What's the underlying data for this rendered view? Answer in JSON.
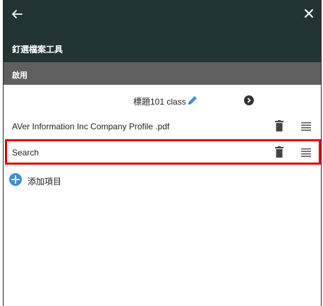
{
  "header": {
    "title": "釘選檔案工具",
    "enabled_label": "啟用"
  },
  "content": {
    "class_title": "標題101 class",
    "items": [
      {
        "name": "AVer Information Inc  Company Profile .pdf"
      },
      {
        "name": "Search"
      }
    ],
    "add_label": "添加項目"
  }
}
